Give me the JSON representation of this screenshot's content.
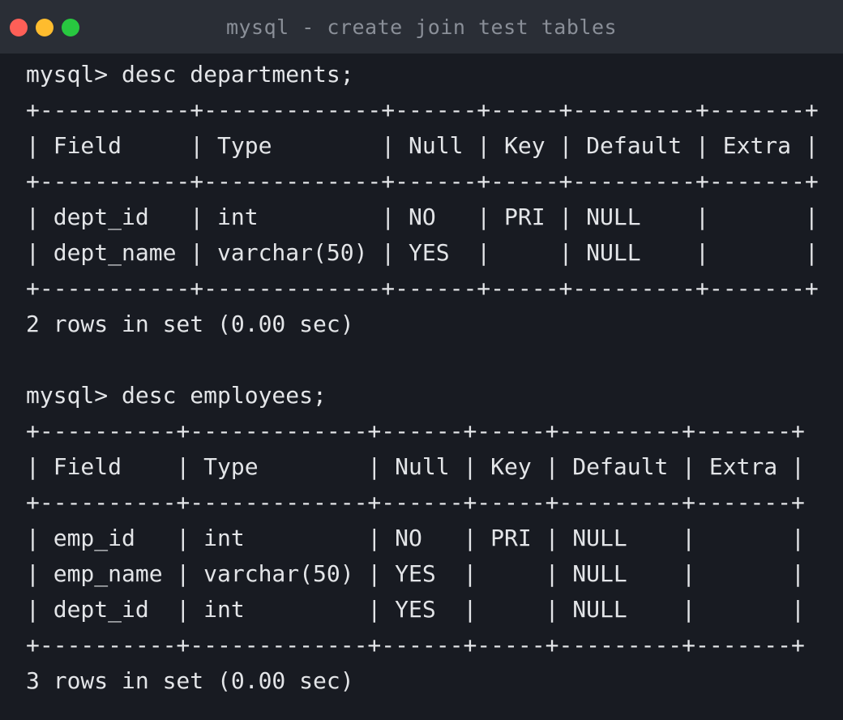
{
  "window": {
    "title": "mysql - create join test tables"
  },
  "terminal": {
    "lines": [
      "mysql> desc departments;",
      "+-----------+-------------+------+-----+---------+-------+",
      "| Field     | Type        | Null | Key | Default | Extra |",
      "+-----------+-------------+------+-----+---------+-------+",
      "| dept_id   | int         | NO   | PRI | NULL    |       |",
      "| dept_name | varchar(50) | YES  |     | NULL    |       |",
      "+-----------+-------------+------+-----+---------+-------+",
      "2 rows in set (0.00 sec)",
      "",
      "mysql> desc employees;",
      "+----------+-------------+------+-----+---------+-------+",
      "| Field    | Type        | Null | Key | Default | Extra |",
      "+----------+-------------+------+-----+---------+-------+",
      "| emp_id   | int         | NO   | PRI | NULL    |       |",
      "| emp_name | varchar(50) | YES  |     | NULL    |       |",
      "| dept_id  | int         | YES  |     | NULL    |       |",
      "+----------+-------------+------+-----+---------+-------+",
      "3 rows in set (0.00 sec)"
    ]
  }
}
